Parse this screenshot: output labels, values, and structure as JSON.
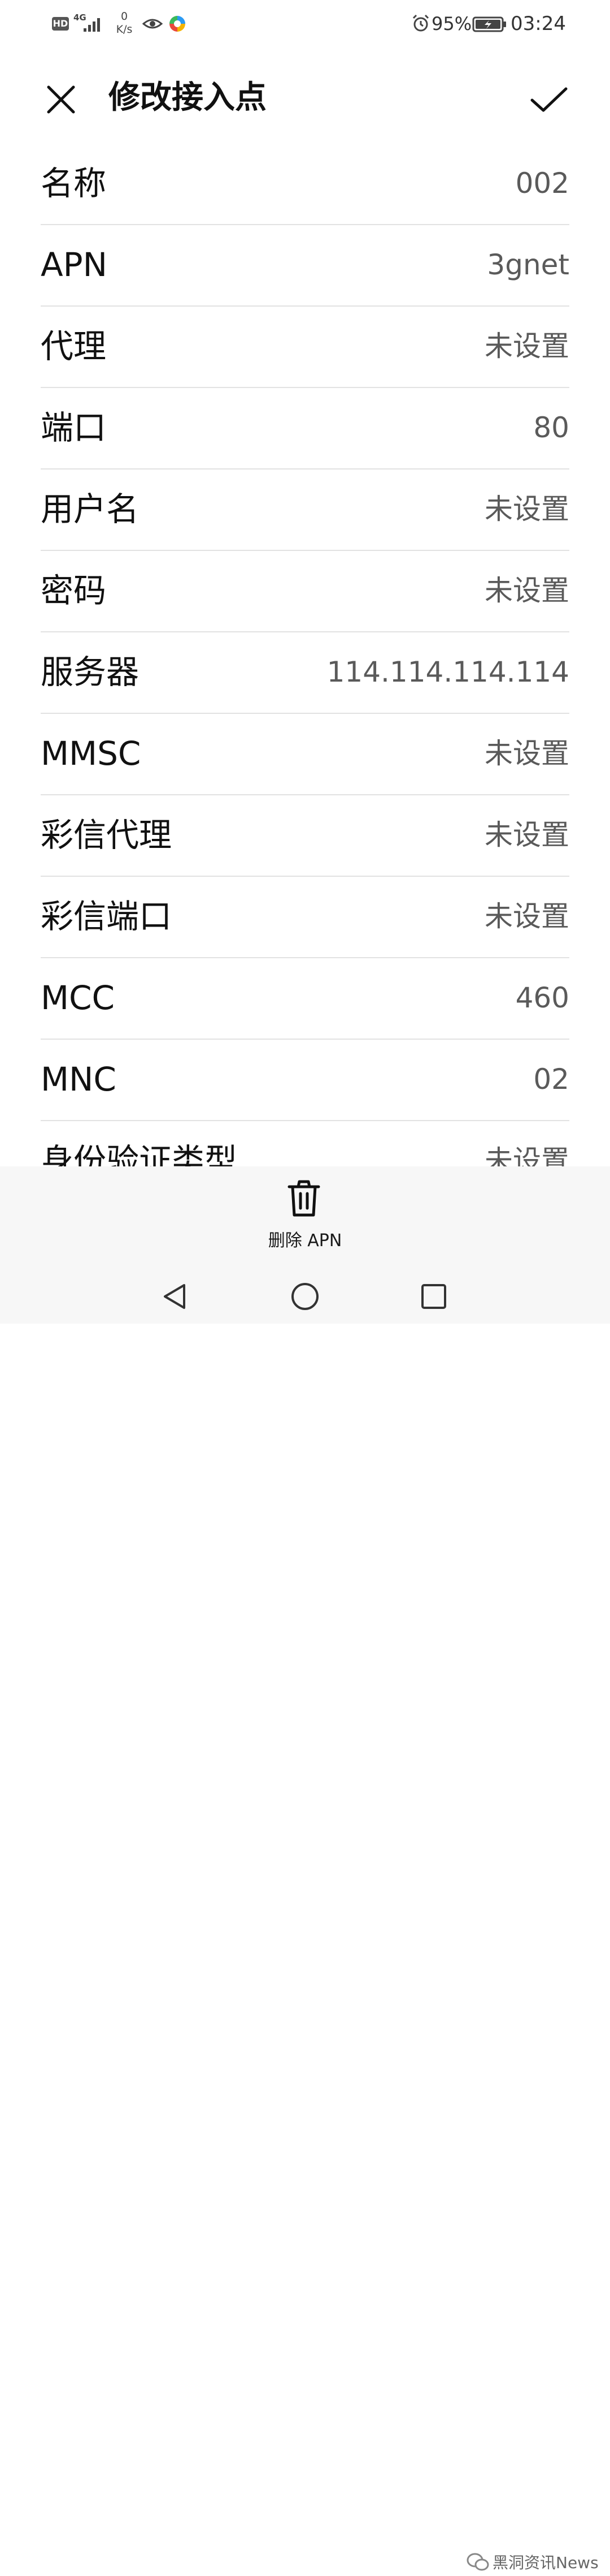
{
  "status_bar": {
    "hd_badge": "HD",
    "network_type": "4G",
    "speed_value": "0",
    "speed_unit": "K/s",
    "battery_percent": "95%",
    "time": "03:24"
  },
  "toolbar": {
    "title": "修改接入点"
  },
  "fields": [
    {
      "label": "名称",
      "value": "002"
    },
    {
      "label": "APN",
      "value": "3gnet"
    },
    {
      "label": "代理",
      "value": "未设置"
    },
    {
      "label": "端口",
      "value": "80"
    },
    {
      "label": "用户名",
      "value": "未设置"
    },
    {
      "label": "密码",
      "value": "未设置"
    },
    {
      "label": "服务器",
      "value": "114.114.114.114"
    },
    {
      "label": "MMSC",
      "value": "未设置"
    },
    {
      "label": "彩信代理",
      "value": "未设置"
    },
    {
      "label": "彩信端口",
      "value": "未设置"
    },
    {
      "label": "MCC",
      "value": "460"
    },
    {
      "label": "MNC",
      "value": "02"
    },
    {
      "label": "身份验证类型",
      "value": "未设置"
    }
  ],
  "bottom_action": {
    "delete_label": "删除 APN"
  },
  "watermark": {
    "text": "黑洞资讯News"
  }
}
